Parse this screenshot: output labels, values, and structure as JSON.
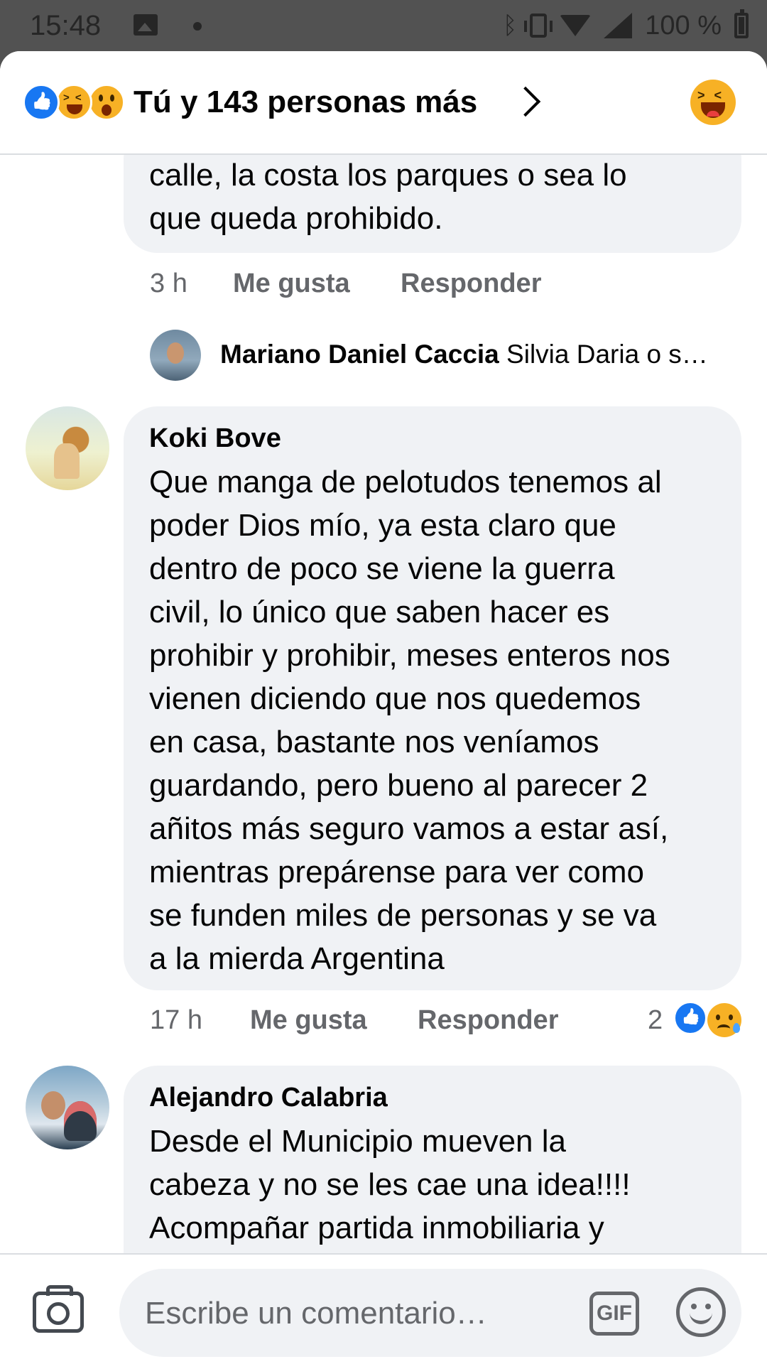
{
  "status_bar": {
    "time": "15:48",
    "battery": "100 %"
  },
  "header": {
    "title": "Tú y 143 personas más",
    "reactions": [
      "like-icon",
      "haha-icon",
      "wow-icon"
    ]
  },
  "comments": [
    {
      "text": "calle, la costa los parques o sea lo\nque queda prohibido.",
      "time": "3 h",
      "like_label": "Me gusta",
      "reply_label": "Responder"
    },
    {
      "reply_author": "Mariano Daniel Caccia",
      "reply_preview": "Silvia Daria o s…"
    },
    {
      "author": "Koki Bove",
      "text": "Que manga de pelotudos tenemos al\npoder Dios mío, ya esta claro que\ndentro de poco se viene la guerra\ncivil, lo único que saben hacer es\nprohibir y prohibir, meses enteros nos\nvienen diciendo que nos quedemos\nen casa, bastante nos veníamos\nguardando, pero bueno al parecer 2\nañitos más seguro vamos a estar así,\nmientras prepárense para ver como\nse funden miles de personas y se va\na la mierda Argentina",
      "time": "17 h",
      "like_label": "Me gusta",
      "reply_label": "Responder",
      "reaction_count": "2"
    },
    {
      "author": "Alejandro Calabria",
      "text": "Desde el Municipio mueven la\ncabeza y no se les cae una idea!!!!\nAcompañar partida inmobiliaria y"
    }
  ],
  "composer": {
    "placeholder": "Escribe un comentario…",
    "gif_label": "GIF"
  },
  "colors": {
    "accent": "#1877f2",
    "bubble": "#f0f2f5",
    "secondary_text": "#65676b"
  }
}
